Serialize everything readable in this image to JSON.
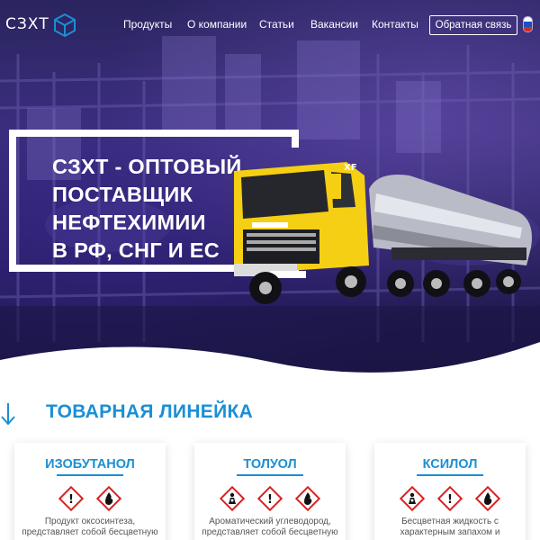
{
  "header": {
    "logo_text": "СЗХТ",
    "nav": [
      "Продукты",
      "О компании",
      "Статьи",
      "Вакансии",
      "Контакты"
    ],
    "feedback_label": "Обратная связь"
  },
  "hero": {
    "headline": [
      "СЗХТ - ОПТОВЫЙ",
      "ПОСТАВЩИК",
      "НЕФТЕХИМИИ",
      "В РФ, СНГ И ЕС"
    ]
  },
  "products": {
    "title": "ТОВАРНАЯ ЛИНЕЙКА",
    "cards": [
      {
        "name": "ИЗОБУТАНОЛ",
        "icons": [
          "exclamation-hazard-icon",
          "flame-hazard-icon"
        ],
        "desc": "Продукт оксосинтеза, представляет собой бесцветную жидкость с характерным запахом"
      },
      {
        "name": "ТОЛУОЛ",
        "icons": [
          "health-hazard-icon",
          "exclamation-hazard-icon",
          "flame-hazard-icon"
        ],
        "desc": "Ароматический углеводород, представляет собой бесцветную жидкость с резким запахом, легко"
      },
      {
        "name": "КСИЛОЛ",
        "icons": [
          "health-hazard-icon",
          "exclamation-hazard-icon",
          "flame-hazard-icon"
        ],
        "desc": "Бесцветная жидкость с характерным запахом и относится к ароматичес"
      }
    ]
  },
  "colors": {
    "accent": "#1b8fd4",
    "hero_bg": "#2a2460",
    "truck_yellow": "#f5cf13"
  }
}
